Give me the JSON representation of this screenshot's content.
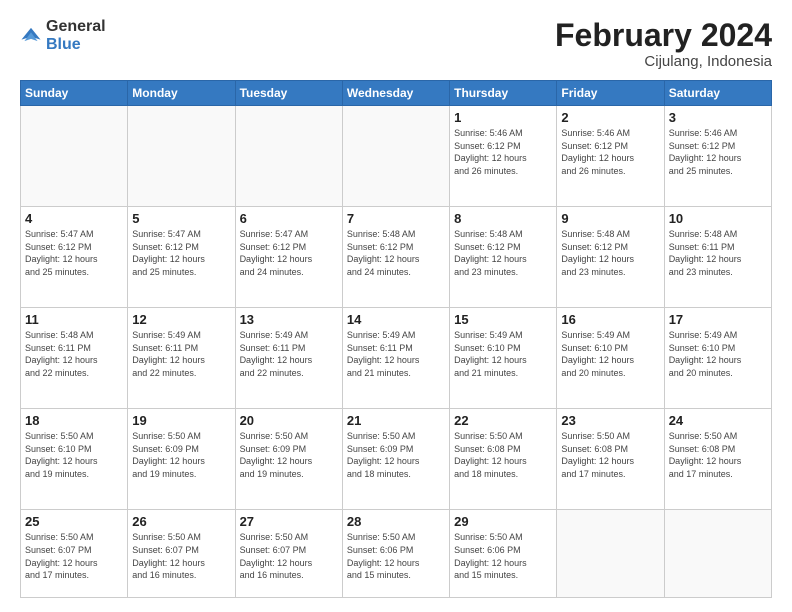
{
  "logo": {
    "general": "General",
    "blue": "Blue"
  },
  "header": {
    "title": "February 2024",
    "subtitle": "Cijulang, Indonesia"
  },
  "weekdays": [
    "Sunday",
    "Monday",
    "Tuesday",
    "Wednesday",
    "Thursday",
    "Friday",
    "Saturday"
  ],
  "weeks": [
    [
      {
        "day": "",
        "info": ""
      },
      {
        "day": "",
        "info": ""
      },
      {
        "day": "",
        "info": ""
      },
      {
        "day": "",
        "info": ""
      },
      {
        "day": "1",
        "info": "Sunrise: 5:46 AM\nSunset: 6:12 PM\nDaylight: 12 hours\nand 26 minutes."
      },
      {
        "day": "2",
        "info": "Sunrise: 5:46 AM\nSunset: 6:12 PM\nDaylight: 12 hours\nand 26 minutes."
      },
      {
        "day": "3",
        "info": "Sunrise: 5:46 AM\nSunset: 6:12 PM\nDaylight: 12 hours\nand 25 minutes."
      }
    ],
    [
      {
        "day": "4",
        "info": "Sunrise: 5:47 AM\nSunset: 6:12 PM\nDaylight: 12 hours\nand 25 minutes."
      },
      {
        "day": "5",
        "info": "Sunrise: 5:47 AM\nSunset: 6:12 PM\nDaylight: 12 hours\nand 25 minutes."
      },
      {
        "day": "6",
        "info": "Sunrise: 5:47 AM\nSunset: 6:12 PM\nDaylight: 12 hours\nand 24 minutes."
      },
      {
        "day": "7",
        "info": "Sunrise: 5:48 AM\nSunset: 6:12 PM\nDaylight: 12 hours\nand 24 minutes."
      },
      {
        "day": "8",
        "info": "Sunrise: 5:48 AM\nSunset: 6:12 PM\nDaylight: 12 hours\nand 23 minutes."
      },
      {
        "day": "9",
        "info": "Sunrise: 5:48 AM\nSunset: 6:12 PM\nDaylight: 12 hours\nand 23 minutes."
      },
      {
        "day": "10",
        "info": "Sunrise: 5:48 AM\nSunset: 6:11 PM\nDaylight: 12 hours\nand 23 minutes."
      }
    ],
    [
      {
        "day": "11",
        "info": "Sunrise: 5:48 AM\nSunset: 6:11 PM\nDaylight: 12 hours\nand 22 minutes."
      },
      {
        "day": "12",
        "info": "Sunrise: 5:49 AM\nSunset: 6:11 PM\nDaylight: 12 hours\nand 22 minutes."
      },
      {
        "day": "13",
        "info": "Sunrise: 5:49 AM\nSunset: 6:11 PM\nDaylight: 12 hours\nand 22 minutes."
      },
      {
        "day": "14",
        "info": "Sunrise: 5:49 AM\nSunset: 6:11 PM\nDaylight: 12 hours\nand 21 minutes."
      },
      {
        "day": "15",
        "info": "Sunrise: 5:49 AM\nSunset: 6:10 PM\nDaylight: 12 hours\nand 21 minutes."
      },
      {
        "day": "16",
        "info": "Sunrise: 5:49 AM\nSunset: 6:10 PM\nDaylight: 12 hours\nand 20 minutes."
      },
      {
        "day": "17",
        "info": "Sunrise: 5:49 AM\nSunset: 6:10 PM\nDaylight: 12 hours\nand 20 minutes."
      }
    ],
    [
      {
        "day": "18",
        "info": "Sunrise: 5:50 AM\nSunset: 6:10 PM\nDaylight: 12 hours\nand 19 minutes."
      },
      {
        "day": "19",
        "info": "Sunrise: 5:50 AM\nSunset: 6:09 PM\nDaylight: 12 hours\nand 19 minutes."
      },
      {
        "day": "20",
        "info": "Sunrise: 5:50 AM\nSunset: 6:09 PM\nDaylight: 12 hours\nand 19 minutes."
      },
      {
        "day": "21",
        "info": "Sunrise: 5:50 AM\nSunset: 6:09 PM\nDaylight: 12 hours\nand 18 minutes."
      },
      {
        "day": "22",
        "info": "Sunrise: 5:50 AM\nSunset: 6:08 PM\nDaylight: 12 hours\nand 18 minutes."
      },
      {
        "day": "23",
        "info": "Sunrise: 5:50 AM\nSunset: 6:08 PM\nDaylight: 12 hours\nand 17 minutes."
      },
      {
        "day": "24",
        "info": "Sunrise: 5:50 AM\nSunset: 6:08 PM\nDaylight: 12 hours\nand 17 minutes."
      }
    ],
    [
      {
        "day": "25",
        "info": "Sunrise: 5:50 AM\nSunset: 6:07 PM\nDaylight: 12 hours\nand 17 minutes."
      },
      {
        "day": "26",
        "info": "Sunrise: 5:50 AM\nSunset: 6:07 PM\nDaylight: 12 hours\nand 16 minutes."
      },
      {
        "day": "27",
        "info": "Sunrise: 5:50 AM\nSunset: 6:07 PM\nDaylight: 12 hours\nand 16 minutes."
      },
      {
        "day": "28",
        "info": "Sunrise: 5:50 AM\nSunset: 6:06 PM\nDaylight: 12 hours\nand 15 minutes."
      },
      {
        "day": "29",
        "info": "Sunrise: 5:50 AM\nSunset: 6:06 PM\nDaylight: 12 hours\nand 15 minutes."
      },
      {
        "day": "",
        "info": ""
      },
      {
        "day": "",
        "info": ""
      }
    ]
  ]
}
